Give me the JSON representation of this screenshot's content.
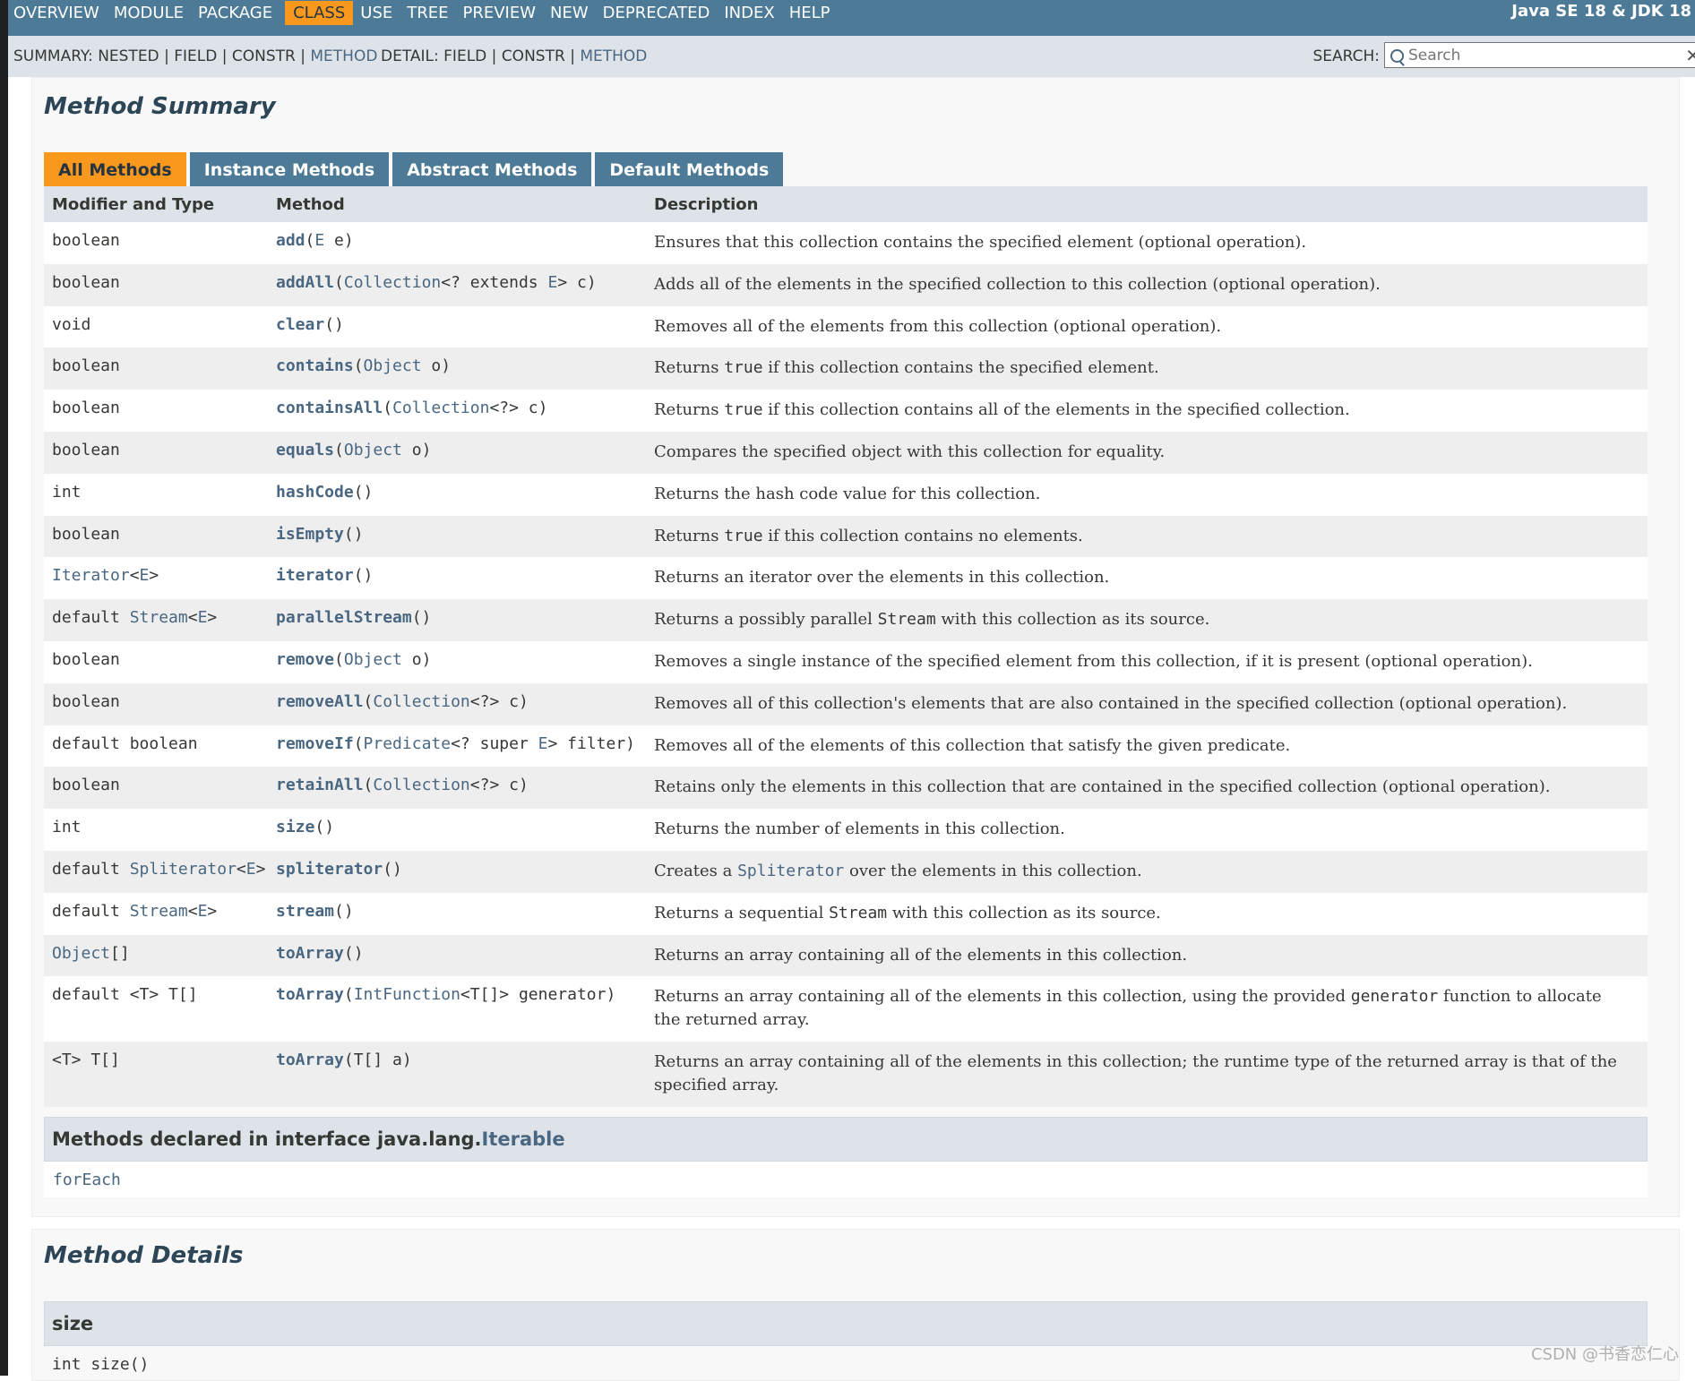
{
  "top_nav": {
    "items": [
      "OVERVIEW",
      "MODULE",
      "PACKAGE",
      "CLASS",
      "USE",
      "TREE",
      "PREVIEW",
      "NEW",
      "DEPRECATED",
      "INDEX",
      "HELP"
    ],
    "active_item": "CLASS",
    "about": "Java SE 18 & JDK 18"
  },
  "sub_nav": {
    "summary_label": "SUMMARY:",
    "summary_nested": "NESTED",
    "summary_field": "FIELD",
    "summary_constr": "CONSTR",
    "summary_method": "METHOD",
    "detail_label": "DETAIL:",
    "detail_field": "FIELD",
    "detail_constr": "CONSTR",
    "detail_method": "METHOD",
    "separator": "|",
    "search_label": "SEARCH:",
    "search_placeholder": "Search"
  },
  "method_summary": {
    "title": "Method Summary",
    "tabs": [
      "All Methods",
      "Instance Methods",
      "Abstract Methods",
      "Default Methods"
    ],
    "active_tab": "All Methods",
    "columns": [
      "Modifier and Type",
      "Method",
      "Description"
    ],
    "rows": [
      {
        "type": [
          {
            "t": "boolean"
          }
        ],
        "method": [
          {
            "t": "add",
            "k": "m"
          },
          {
            "t": "("
          },
          {
            "t": "E",
            "k": "l"
          },
          {
            "t": " e)"
          }
        ],
        "desc": [
          {
            "t": "Ensures that this collection contains the specified element (optional operation)."
          }
        ]
      },
      {
        "type": [
          {
            "t": "boolean"
          }
        ],
        "method": [
          {
            "t": "addAll",
            "k": "m"
          },
          {
            "t": "("
          },
          {
            "t": "Collection",
            "k": "l"
          },
          {
            "t": "<? extends "
          },
          {
            "t": "E",
            "k": "l"
          },
          {
            "t": "> c)"
          }
        ],
        "desc": [
          {
            "t": "Adds all of the elements in the specified collection to this collection (optional operation)."
          }
        ]
      },
      {
        "type": [
          {
            "t": "void"
          }
        ],
        "method": [
          {
            "t": "clear",
            "k": "m"
          },
          {
            "t": "()"
          }
        ],
        "desc": [
          {
            "t": "Removes all of the elements from this collection (optional operation)."
          }
        ]
      },
      {
        "type": [
          {
            "t": "boolean"
          }
        ],
        "method": [
          {
            "t": "contains",
            "k": "m"
          },
          {
            "t": "("
          },
          {
            "t": "Object",
            "k": "l"
          },
          {
            "t": " o)"
          }
        ],
        "desc": [
          {
            "t": "Returns "
          },
          {
            "t": "true",
            "k": "c"
          },
          {
            "t": " if this collection contains the specified element."
          }
        ]
      },
      {
        "type": [
          {
            "t": "boolean"
          }
        ],
        "method": [
          {
            "t": "containsAll",
            "k": "m"
          },
          {
            "t": "("
          },
          {
            "t": "Collection",
            "k": "l"
          },
          {
            "t": "<?> c)"
          }
        ],
        "desc": [
          {
            "t": "Returns "
          },
          {
            "t": "true",
            "k": "c"
          },
          {
            "t": " if this collection contains all of the elements in the specified collection."
          }
        ]
      },
      {
        "type": [
          {
            "t": "boolean"
          }
        ],
        "method": [
          {
            "t": "equals",
            "k": "m"
          },
          {
            "t": "("
          },
          {
            "t": "Object",
            "k": "l"
          },
          {
            "t": " o)"
          }
        ],
        "desc": [
          {
            "t": "Compares the specified object with this collection for equality."
          }
        ]
      },
      {
        "type": [
          {
            "t": "int"
          }
        ],
        "method": [
          {
            "t": "hashCode",
            "k": "m"
          },
          {
            "t": "()"
          }
        ],
        "desc": [
          {
            "t": "Returns the hash code value for this collection."
          }
        ]
      },
      {
        "type": [
          {
            "t": "boolean"
          }
        ],
        "method": [
          {
            "t": "isEmpty",
            "k": "m"
          },
          {
            "t": "()"
          }
        ],
        "desc": [
          {
            "t": "Returns "
          },
          {
            "t": "true",
            "k": "c"
          },
          {
            "t": " if this collection contains no elements."
          }
        ]
      },
      {
        "type": [
          {
            "t": "Iterator",
            "k": "l"
          },
          {
            "t": "<"
          },
          {
            "t": "E",
            "k": "l"
          },
          {
            "t": ">"
          }
        ],
        "method": [
          {
            "t": "iterator",
            "k": "m"
          },
          {
            "t": "()"
          }
        ],
        "desc": [
          {
            "t": "Returns an iterator over the elements in this collection."
          }
        ]
      },
      {
        "type": [
          {
            "t": "default "
          },
          {
            "t": "Stream",
            "k": "l"
          },
          {
            "t": "<"
          },
          {
            "t": "E",
            "k": "l"
          },
          {
            "t": ">"
          }
        ],
        "method": [
          {
            "t": "parallelStream",
            "k": "m"
          },
          {
            "t": "()"
          }
        ],
        "desc": [
          {
            "t": "Returns a possibly parallel "
          },
          {
            "t": "Stream",
            "k": "c"
          },
          {
            "t": " with this collection as its source."
          }
        ]
      },
      {
        "type": [
          {
            "t": "boolean"
          }
        ],
        "method": [
          {
            "t": "remove",
            "k": "m"
          },
          {
            "t": "("
          },
          {
            "t": "Object",
            "k": "l"
          },
          {
            "t": " o)"
          }
        ],
        "desc": [
          {
            "t": "Removes a single instance of the specified element from this collection, if it is present (optional operation)."
          }
        ]
      },
      {
        "type": [
          {
            "t": "boolean"
          }
        ],
        "method": [
          {
            "t": "removeAll",
            "k": "m"
          },
          {
            "t": "("
          },
          {
            "t": "Collection",
            "k": "l"
          },
          {
            "t": "<?> c)"
          }
        ],
        "desc": [
          {
            "t": "Removes all of this collection's elements that are also contained in the specified collection (optional operation)."
          }
        ]
      },
      {
        "type": [
          {
            "t": "default boolean"
          }
        ],
        "method": [
          {
            "t": "removeIf",
            "k": "m"
          },
          {
            "t": "("
          },
          {
            "t": "Predicate",
            "k": "l"
          },
          {
            "t": "<? super "
          },
          {
            "t": "E",
            "k": "l"
          },
          {
            "t": "> filter)"
          }
        ],
        "desc": [
          {
            "t": "Removes all of the elements of this collection that satisfy the given predicate."
          }
        ]
      },
      {
        "type": [
          {
            "t": "boolean"
          }
        ],
        "method": [
          {
            "t": "retainAll",
            "k": "m"
          },
          {
            "t": "("
          },
          {
            "t": "Collection",
            "k": "l"
          },
          {
            "t": "<?> c)"
          }
        ],
        "desc": [
          {
            "t": "Retains only the elements in this collection that are contained in the specified collection (optional operation)."
          }
        ]
      },
      {
        "type": [
          {
            "t": "int"
          }
        ],
        "method": [
          {
            "t": "size",
            "k": "m"
          },
          {
            "t": "()"
          }
        ],
        "desc": [
          {
            "t": "Returns the number of elements in this collection."
          }
        ]
      },
      {
        "type": [
          {
            "t": "default "
          },
          {
            "t": "Spliterator",
            "k": "l"
          },
          {
            "t": "<"
          },
          {
            "t": "E",
            "k": "l"
          },
          {
            "t": ">"
          }
        ],
        "method": [
          {
            "t": "spliterator",
            "k": "m"
          },
          {
            "t": "()"
          }
        ],
        "desc": [
          {
            "t": "Creates a "
          },
          {
            "t": "Spliterator",
            "k": "lc"
          },
          {
            "t": " over the elements in this collection."
          }
        ]
      },
      {
        "type": [
          {
            "t": "default "
          },
          {
            "t": "Stream",
            "k": "l"
          },
          {
            "t": "<"
          },
          {
            "t": "E",
            "k": "l"
          },
          {
            "t": ">"
          }
        ],
        "method": [
          {
            "t": "stream",
            "k": "m"
          },
          {
            "t": "()"
          }
        ],
        "desc": [
          {
            "t": "Returns a sequential "
          },
          {
            "t": "Stream",
            "k": "c"
          },
          {
            "t": " with this collection as its source."
          }
        ]
      },
      {
        "type": [
          {
            "t": "Object",
            "k": "l"
          },
          {
            "t": "[]"
          }
        ],
        "method": [
          {
            "t": "toArray",
            "k": "m"
          },
          {
            "t": "()"
          }
        ],
        "desc": [
          {
            "t": "Returns an array containing all of the elements in this collection."
          }
        ]
      },
      {
        "type": [
          {
            "t": "default <T> T[]"
          }
        ],
        "method": [
          {
            "t": "toArray",
            "k": "m"
          },
          {
            "t": "("
          },
          {
            "t": "IntFunction",
            "k": "l"
          },
          {
            "t": "<T[]> generator)"
          }
        ],
        "desc": [
          {
            "t": "Returns an array containing all of the elements in this collection, using the provided "
          },
          {
            "t": "generator",
            "k": "c"
          },
          {
            "t": " function to allocate the returned array."
          }
        ],
        "double": true
      },
      {
        "type": [
          {
            "t": "<T> T[]"
          }
        ],
        "method": [
          {
            "t": "toArray",
            "k": "m"
          },
          {
            "t": "(T[] a)"
          }
        ],
        "desc": [
          {
            "t": "Returns an array containing all of the elements in this collection; the runtime type of the returned array is that of the specified array."
          }
        ],
        "double": true
      }
    ]
  },
  "inherited": {
    "prefix": "Methods declared in interface java.lang.",
    "interface_link": "Iterable",
    "methods": [
      "forEach"
    ]
  },
  "method_details": {
    "title": "Method Details",
    "first_method": "size",
    "first_signature": "int size()"
  },
  "watermark": "CSDN @书香恋仁心"
}
